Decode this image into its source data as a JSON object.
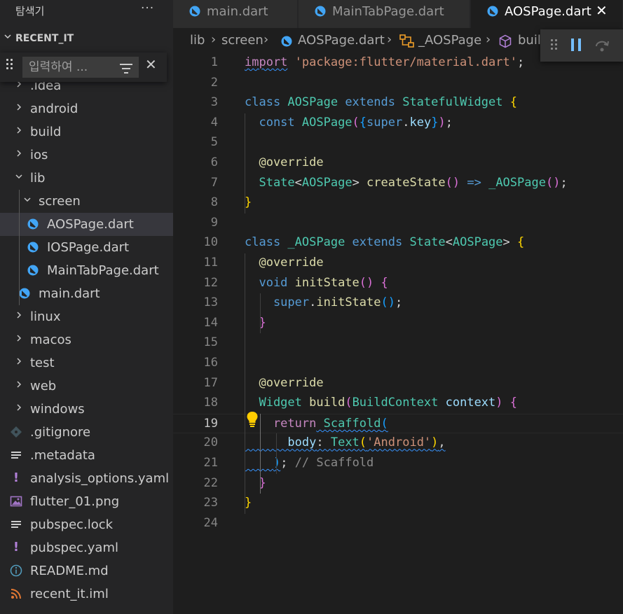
{
  "sidebar": {
    "title": "탐색기",
    "more": "···",
    "section_label": "RECENT_IT",
    "filter": {
      "placeholder": "입력하여 ..."
    },
    "items": [
      {
        "label": ".idea",
        "kind": "folder",
        "expanded": false
      },
      {
        "label": "android",
        "kind": "folder",
        "expanded": false
      },
      {
        "label": "build",
        "kind": "folder",
        "expanded": false
      },
      {
        "label": "ios",
        "kind": "folder",
        "expanded": false
      },
      {
        "label": "lib",
        "kind": "folder",
        "expanded": true
      },
      {
        "label": "screen",
        "kind": "folder",
        "expanded": true
      },
      {
        "label": "AOSPage.dart",
        "kind": "dart",
        "selected": true
      },
      {
        "label": "IOSPage.dart",
        "kind": "dart"
      },
      {
        "label": "MainTabPage.dart",
        "kind": "dart"
      },
      {
        "label": "main.dart",
        "kind": "dart"
      },
      {
        "label": "linux",
        "kind": "folder",
        "expanded": false
      },
      {
        "label": "macos",
        "kind": "folder",
        "expanded": false
      },
      {
        "label": "test",
        "kind": "folder",
        "expanded": false
      },
      {
        "label": "web",
        "kind": "folder",
        "expanded": false
      },
      {
        "label": "windows",
        "kind": "folder",
        "expanded": false
      },
      {
        "label": ".gitignore",
        "kind": "git"
      },
      {
        "label": ".metadata",
        "kind": "text"
      },
      {
        "label": "analysis_options.yaml",
        "kind": "yaml"
      },
      {
        "label": "flutter_01.png",
        "kind": "image"
      },
      {
        "label": "pubspec.lock",
        "kind": "text"
      },
      {
        "label": "pubspec.yaml",
        "kind": "yaml"
      },
      {
        "label": "README.md",
        "kind": "info"
      },
      {
        "label": "recent_it.iml",
        "kind": "rss"
      }
    ]
  },
  "tabs": [
    {
      "label": "main.dart",
      "active": false
    },
    {
      "label": "MainTabPage.dart",
      "active": false
    },
    {
      "label": "AOSPage.dart",
      "active": true,
      "close": "✕"
    }
  ],
  "breadcrumb": {
    "parts": [
      "lib",
      "screen",
      "AOSPage.dart",
      "_AOSPage",
      "buil"
    ],
    "separator": "›"
  },
  "editor": {
    "active_line": 19,
    "lines": [
      [
        [
          "tk-ctl squig",
          "import"
        ],
        [
          "",
          ""
        ],
        [
          "tk-str",
          " 'package:flutter/material.dart'"
        ],
        [
          "",
          ";"
        ]
      ],
      [],
      [
        [
          "tk-key",
          "class"
        ],
        [
          "",
          ""
        ],
        [
          "tk-cls",
          " AOSPage"
        ],
        [
          "tk-key",
          " extends"
        ],
        [
          "tk-cls",
          " StatefulWidget"
        ],
        [
          "tk-b1",
          " {"
        ]
      ],
      [
        [
          "",
          ""
        ],
        [
          "tk-key",
          "  const"
        ],
        [
          "tk-cls",
          " AOSPage"
        ],
        [
          "tk-b2",
          "("
        ],
        [
          "tk-b3",
          "{"
        ],
        [
          "tk-key",
          "super"
        ],
        [
          "",
          "."
        ],
        [
          "tk-var",
          "key"
        ],
        [
          "tk-b3",
          "}"
        ],
        [
          "tk-b2",
          ")"
        ],
        [
          "",
          ";"
        ]
      ],
      [],
      [
        [
          "tk-fn",
          "  @override"
        ]
      ],
      [
        [
          "tk-cls",
          "  State"
        ],
        [
          "",
          "<"
        ],
        [
          "tk-cls",
          "AOSPage"
        ],
        [
          "",
          "> "
        ],
        [
          "tk-fn",
          "createState"
        ],
        [
          "tk-b2",
          "()"
        ],
        [
          "",
          ""
        ],
        [
          "tk-key",
          " =>"
        ],
        [
          "tk-cls",
          " _AOSPage"
        ],
        [
          "tk-b2",
          "()"
        ],
        [
          "",
          ";"
        ]
      ],
      [
        [
          "tk-b1",
          "}"
        ]
      ],
      [],
      [
        [
          "tk-key",
          "class"
        ],
        [
          "tk-cls",
          " _AOSPage"
        ],
        [
          "tk-key",
          " extends"
        ],
        [
          "tk-cls",
          " State"
        ],
        [
          "",
          "<"
        ],
        [
          "tk-cls",
          "AOSPage"
        ],
        [
          "",
          ">"
        ],
        [
          "tk-b1",
          " {"
        ]
      ],
      [
        [
          "tk-fn",
          "  @override"
        ]
      ],
      [
        [
          "tk-key",
          "  void"
        ],
        [
          "tk-fn",
          " initState"
        ],
        [
          "tk-b2",
          "()"
        ],
        [
          "tk-b2",
          " {"
        ]
      ],
      [
        [
          "tk-key",
          "    super"
        ],
        [
          "",
          "."
        ],
        [
          "tk-fn",
          "initState"
        ],
        [
          "tk-b3",
          "()"
        ],
        [
          "",
          ";"
        ]
      ],
      [
        [
          "tk-b2",
          "  }"
        ]
      ],
      [],
      [],
      [
        [
          "tk-fn",
          "  @override"
        ]
      ],
      [
        [
          "tk-cls",
          "  Widget"
        ],
        [
          "tk-fn",
          " build"
        ],
        [
          "tk-b2",
          "("
        ],
        [
          "tk-cls",
          "BuildContext"
        ],
        [
          "tk-var",
          " context"
        ],
        [
          "tk-b2",
          ")"
        ],
        [
          "tk-b2",
          " {"
        ]
      ],
      [
        [
          "tk-ctl",
          "    return"
        ],
        [
          "",
          ""
        ],
        [
          "tk-cls squig",
          " Scaffold"
        ],
        [
          "tk-b3 squig",
          "("
        ]
      ],
      [
        [
          "tk-var squig",
          "      body"
        ],
        [
          "squig",
          ": "
        ],
        [
          "tk-cls squig",
          "Text"
        ],
        [
          "tk-b1 squig",
          "("
        ],
        [
          "tk-str squig",
          "'Android'"
        ],
        [
          "tk-b1 squig",
          ")"
        ],
        [
          "squig",
          ","
        ]
      ],
      [
        [
          "squig",
          "    "
        ],
        [
          "tk-b3 squig",
          ")"
        ],
        [
          "",
          ";"
        ],
        [
          "tk-hint",
          " // Scaffold"
        ]
      ],
      [
        [
          "tk-b2",
          "  }"
        ]
      ],
      [
        [
          "tk-b1",
          "}"
        ]
      ],
      []
    ]
  },
  "colors": {
    "accent": "#3794ff",
    "dart_icon": "#42a5f5",
    "selected_row": "#37373d",
    "debug_pause": "#75beff"
  }
}
